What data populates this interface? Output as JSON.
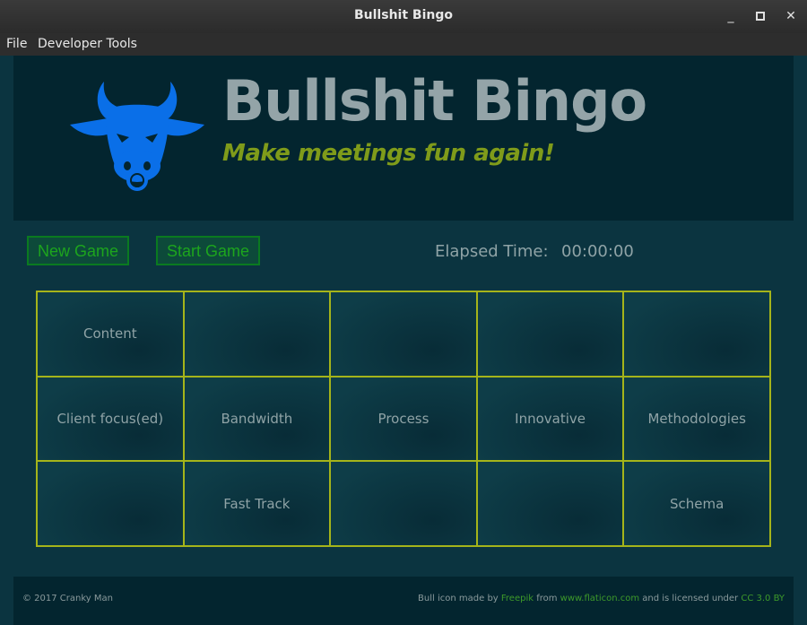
{
  "window": {
    "title": "Bullshit Bingo",
    "controls": {
      "minimize": "_",
      "maximize": "▫",
      "close": "✕"
    }
  },
  "menu": {
    "file": "File",
    "developer_tools": "Developer Tools"
  },
  "header": {
    "logo_icon": "bull-icon",
    "title": "Bullshit Bingo",
    "tagline": "Make meetings fun again!"
  },
  "controls": {
    "new_game": "New Game",
    "start_game": "Start Game",
    "elapsed_label": "Elapsed Time:",
    "elapsed_value": "00:00:00"
  },
  "board": {
    "cells": [
      "Content",
      "",
      "",
      "",
      "",
      "Client focus(ed)",
      "Bandwidth",
      "Process",
      "Innovative",
      "Methodologies",
      "",
      "Fast Track",
      "",
      "",
      "Schema"
    ]
  },
  "footer": {
    "copyright": "© 2017 Cranky Man",
    "credit_prefix": "Bull icon made by ",
    "credit_author": "Freepik",
    "credit_from": " from ",
    "credit_site": "www.flaticon.com",
    "credit_license_text": " and is licensed under ",
    "credit_license": "CC 3.0 BY"
  },
  "colors": {
    "background": "#0b3440",
    "header_bg": "#03252f",
    "title": "#94a4a8",
    "tagline": "#7f9b1a",
    "grid_border": "#a5b41a",
    "button_text": "#1da51d",
    "logo": "#0a6fe8"
  }
}
